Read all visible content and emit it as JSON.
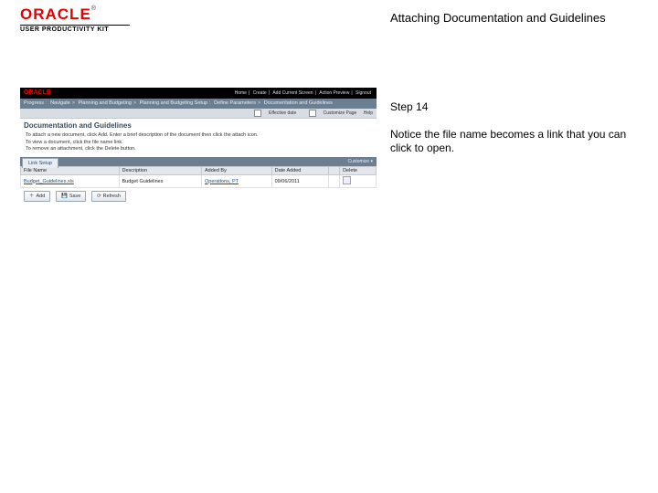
{
  "logo": {
    "brand": "ORACLE",
    "tm": "®",
    "product": "USER PRODUCTIVITY KIT"
  },
  "right": {
    "title": "Attaching Documentation and Guidelines",
    "step": "Step 14",
    "body": "Notice the file name becomes a link that you can click to open."
  },
  "app": {
    "topbar": {
      "brand": "ORACLE",
      "links": [
        "Home",
        "Create",
        "Add Current Screen",
        "Action Preview",
        "Signout"
      ]
    },
    "breadcrumb": {
      "items": [
        "Progress",
        "Navigate",
        "Planning and Budgeting",
        "Planning and Budgeting Setup",
        "Define Parameters",
        "Documentation and Guidelines"
      ]
    },
    "subbar": {
      "items": [
        "Effective date",
        "Customize Page",
        "Help"
      ]
    },
    "heading": "Documentation and Guidelines",
    "instructions": [
      "To attach a new document, click Add. Enter a brief description of the document then click the attach icon.",
      "To view a document, click the file name link.",
      "To remove an attachment, click the Delete button."
    ],
    "tab": "Link Setup",
    "tab_customize": "Customize",
    "columns": [
      "File Name",
      "Description",
      "Added By",
      "Date Added",
      "",
      "Delete"
    ],
    "row": {
      "file": "Budget_Guidelines.xls",
      "desc": "Budget Guidelines",
      "added_by": "Operations, PT",
      "date": "09/06/2011",
      "del": ""
    },
    "buttons": {
      "add": "Add",
      "save": "Save",
      "refresh": "Refresh"
    },
    "icons": {
      "add": "＋",
      "save": "💾",
      "refresh": "⟳"
    }
  }
}
